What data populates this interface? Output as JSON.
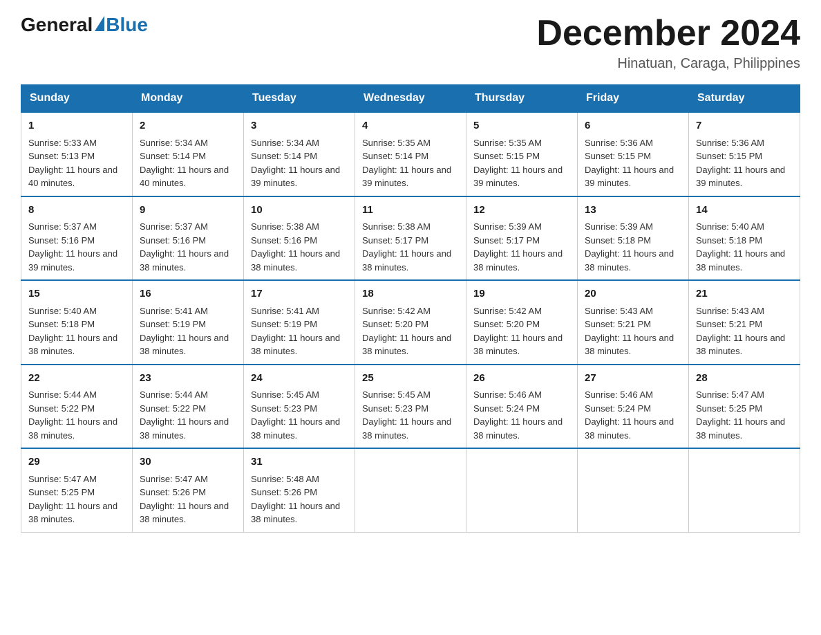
{
  "logo": {
    "general": "General",
    "blue": "Blue",
    "triangle": true
  },
  "title": "December 2024",
  "location": "Hinatuan, Caraga, Philippines",
  "days_header": [
    "Sunday",
    "Monday",
    "Tuesday",
    "Wednesday",
    "Thursday",
    "Friday",
    "Saturday"
  ],
  "weeks": [
    [
      {
        "day": "1",
        "sunrise": "5:33 AM",
        "sunset": "5:13 PM",
        "daylight": "11 hours and 40 minutes."
      },
      {
        "day": "2",
        "sunrise": "5:34 AM",
        "sunset": "5:14 PM",
        "daylight": "11 hours and 40 minutes."
      },
      {
        "day": "3",
        "sunrise": "5:34 AM",
        "sunset": "5:14 PM",
        "daylight": "11 hours and 39 minutes."
      },
      {
        "day": "4",
        "sunrise": "5:35 AM",
        "sunset": "5:14 PM",
        "daylight": "11 hours and 39 minutes."
      },
      {
        "day": "5",
        "sunrise": "5:35 AM",
        "sunset": "5:15 PM",
        "daylight": "11 hours and 39 minutes."
      },
      {
        "day": "6",
        "sunrise": "5:36 AM",
        "sunset": "5:15 PM",
        "daylight": "11 hours and 39 minutes."
      },
      {
        "day": "7",
        "sunrise": "5:36 AM",
        "sunset": "5:15 PM",
        "daylight": "11 hours and 39 minutes."
      }
    ],
    [
      {
        "day": "8",
        "sunrise": "5:37 AM",
        "sunset": "5:16 PM",
        "daylight": "11 hours and 39 minutes."
      },
      {
        "day": "9",
        "sunrise": "5:37 AM",
        "sunset": "5:16 PM",
        "daylight": "11 hours and 38 minutes."
      },
      {
        "day": "10",
        "sunrise": "5:38 AM",
        "sunset": "5:16 PM",
        "daylight": "11 hours and 38 minutes."
      },
      {
        "day": "11",
        "sunrise": "5:38 AM",
        "sunset": "5:17 PM",
        "daylight": "11 hours and 38 minutes."
      },
      {
        "day": "12",
        "sunrise": "5:39 AM",
        "sunset": "5:17 PM",
        "daylight": "11 hours and 38 minutes."
      },
      {
        "day": "13",
        "sunrise": "5:39 AM",
        "sunset": "5:18 PM",
        "daylight": "11 hours and 38 minutes."
      },
      {
        "day": "14",
        "sunrise": "5:40 AM",
        "sunset": "5:18 PM",
        "daylight": "11 hours and 38 minutes."
      }
    ],
    [
      {
        "day": "15",
        "sunrise": "5:40 AM",
        "sunset": "5:18 PM",
        "daylight": "11 hours and 38 minutes."
      },
      {
        "day": "16",
        "sunrise": "5:41 AM",
        "sunset": "5:19 PM",
        "daylight": "11 hours and 38 minutes."
      },
      {
        "day": "17",
        "sunrise": "5:41 AM",
        "sunset": "5:19 PM",
        "daylight": "11 hours and 38 minutes."
      },
      {
        "day": "18",
        "sunrise": "5:42 AM",
        "sunset": "5:20 PM",
        "daylight": "11 hours and 38 minutes."
      },
      {
        "day": "19",
        "sunrise": "5:42 AM",
        "sunset": "5:20 PM",
        "daylight": "11 hours and 38 minutes."
      },
      {
        "day": "20",
        "sunrise": "5:43 AM",
        "sunset": "5:21 PM",
        "daylight": "11 hours and 38 minutes."
      },
      {
        "day": "21",
        "sunrise": "5:43 AM",
        "sunset": "5:21 PM",
        "daylight": "11 hours and 38 minutes."
      }
    ],
    [
      {
        "day": "22",
        "sunrise": "5:44 AM",
        "sunset": "5:22 PM",
        "daylight": "11 hours and 38 minutes."
      },
      {
        "day": "23",
        "sunrise": "5:44 AM",
        "sunset": "5:22 PM",
        "daylight": "11 hours and 38 minutes."
      },
      {
        "day": "24",
        "sunrise": "5:45 AM",
        "sunset": "5:23 PM",
        "daylight": "11 hours and 38 minutes."
      },
      {
        "day": "25",
        "sunrise": "5:45 AM",
        "sunset": "5:23 PM",
        "daylight": "11 hours and 38 minutes."
      },
      {
        "day": "26",
        "sunrise": "5:46 AM",
        "sunset": "5:24 PM",
        "daylight": "11 hours and 38 minutes."
      },
      {
        "day": "27",
        "sunrise": "5:46 AM",
        "sunset": "5:24 PM",
        "daylight": "11 hours and 38 minutes."
      },
      {
        "day": "28",
        "sunrise": "5:47 AM",
        "sunset": "5:25 PM",
        "daylight": "11 hours and 38 minutes."
      }
    ],
    [
      {
        "day": "29",
        "sunrise": "5:47 AM",
        "sunset": "5:25 PM",
        "daylight": "11 hours and 38 minutes."
      },
      {
        "day": "30",
        "sunrise": "5:47 AM",
        "sunset": "5:26 PM",
        "daylight": "11 hours and 38 minutes."
      },
      {
        "day": "31",
        "sunrise": "5:48 AM",
        "sunset": "5:26 PM",
        "daylight": "11 hours and 38 minutes."
      },
      null,
      null,
      null,
      null
    ]
  ],
  "labels": {
    "sunrise": "Sunrise:",
    "sunset": "Sunset:",
    "daylight": "Daylight:"
  }
}
